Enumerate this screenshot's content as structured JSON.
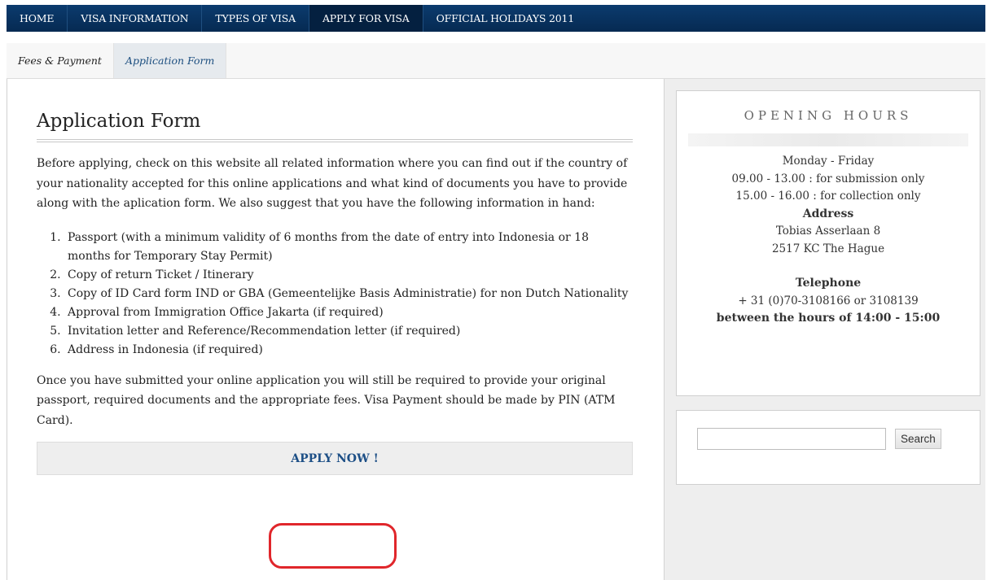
{
  "topnav": {
    "items": [
      {
        "label": "HOME"
      },
      {
        "label": "VISA INFORMATION"
      },
      {
        "label": "TYPES OF VISA"
      },
      {
        "label": "APPLY FOR VISA",
        "active": true
      },
      {
        "label": "OFFICIAL HOLIDAYS 2011"
      }
    ]
  },
  "subnav": {
    "items": [
      {
        "label": "Fees & Payment"
      },
      {
        "label": "Application Form",
        "active": true
      }
    ]
  },
  "main": {
    "title": "Application Form",
    "intro": "Before applying, check on this website  all related information where you can find out if the country of your nationality accepted for this online applications and what kind of documents you have to provide along with the aplication form. We also suggest that you have the following information in hand:",
    "requirements": [
      "Passport  (with a minimum validity of 6 months from the date of entry into Indonesia or 18 months for Temporary Stay Permit)",
      "Copy of  return Ticket / Itinerary",
      "Copy of ID Card form IND or GBA (Gemeentelijke Basis Administratie) for non Dutch Nationality",
      "Approval from Immigration Office Jakarta (if required)",
      "Invitation letter and Reference/Recommendation letter (if required)",
      "Address in Indonesia (if required)"
    ],
    "outro": "Once you have submitted your online application you will still be required to provide your original passport, required documents and the appropriate fees. Visa Payment should be made by PIN (ATM Card).",
    "apply_label": "APPLY NOW !"
  },
  "sidebar": {
    "hours_title": "OPENING HOURS",
    "days": "Monday - Friday",
    "submission": "09.00 - 13.00 : for submission only",
    "collection": "15.00 - 16.00 : for collection only",
    "address_heading": "Address",
    "address_line1": "Tobias Asserlaan 8",
    "address_line2": "2517 KC The Hague",
    "telephone_heading": "Telephone",
    "telephone": "+ 31 (0)70-3108166 or 3108139",
    "phone_hours": "between the hours of 14:00 - 15:00",
    "search_value": "",
    "search_button": "Search"
  },
  "colors": {
    "nav_bg": "#062a52",
    "link": "#1d4f86",
    "highlight_circle": "#e0262b"
  }
}
